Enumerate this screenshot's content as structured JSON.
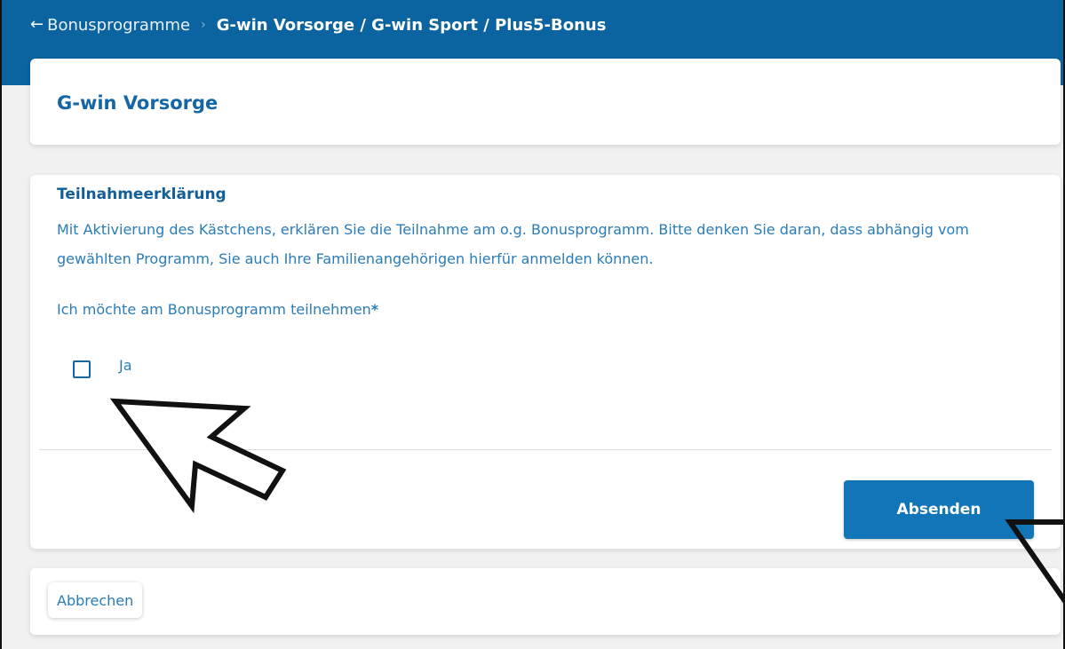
{
  "header": {
    "back_label": "Bonusprogramme",
    "current": "G-win Vorsorge / G-win Sport / Plus5-Bonus",
    "bg_color": "#0b63a0"
  },
  "title_card": {
    "title": "G-win Vorsorge"
  },
  "form": {
    "heading": "Teilnahmeerklärung",
    "description": "Mit Aktivierung des Kästchens, erklären Sie die Teilnahme am o.g. Bonusprogramm. Bitte denken Sie daran, dass abhängig vom gewählten Programm, Sie auch Ihre Familienangehörigen hierfür anmelden können.",
    "question": "Ich möchte am Bonusprogramm teilnehmen",
    "required_marker": "*",
    "checkbox_label": "Ja",
    "checkbox_checked": false,
    "submit_label": "Absenden",
    "accent_color": "#1275b8"
  },
  "footer": {
    "cancel_label": "Abbrechen"
  },
  "icons": {
    "back": "arrow-left-icon",
    "annotation": "arrow-pointer-icon"
  }
}
